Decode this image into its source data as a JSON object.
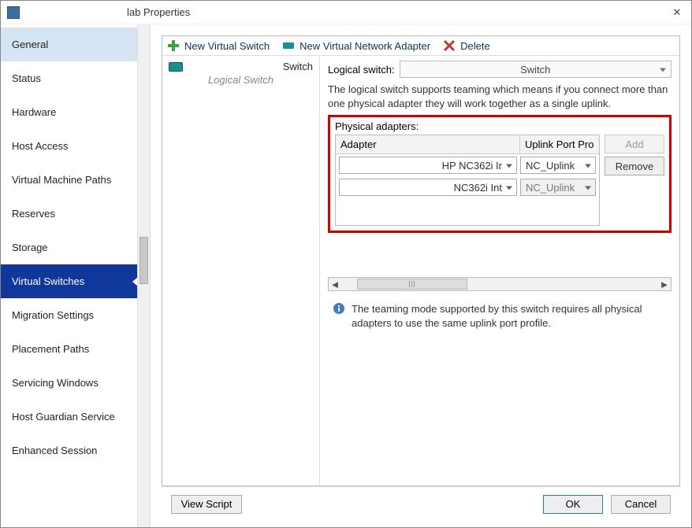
{
  "window": {
    "title": "lab Properties"
  },
  "nav": {
    "items": [
      "General",
      "Status",
      "Hardware",
      "Host Access",
      "Virtual Machine Paths",
      "Reserves",
      "Storage",
      "Virtual Switches",
      "Migration Settings",
      "Placement Paths",
      "Servicing Windows",
      "Host Guardian Service",
      "Enhanced Session"
    ],
    "highlighted": "General",
    "selected": "Virtual Switches"
  },
  "toolbar": {
    "new_switch": "New Virtual Switch",
    "new_adapter": "New Virtual Network Adapter",
    "delete": "Delete"
  },
  "switch_list": {
    "name": "Switch",
    "subtitle": "Logical Switch"
  },
  "detail": {
    "logical_switch_label": "Logical switch:",
    "logical_switch_value": "Switch",
    "help_text": "The logical switch supports teaming which means if you connect more than one physical adapter they will work together as a single uplink.",
    "physical_adapters_label": "Physical adapters:",
    "columns": {
      "adapter": "Adapter",
      "uplink": "Uplink Port Pro"
    },
    "rows": [
      {
        "adapter": "HP NC362i Ir",
        "uplink": "NC_Uplink",
        "uplink_disabled": false
      },
      {
        "adapter": "NC362i Int",
        "uplink": "NC_Uplink",
        "uplink_disabled": true
      }
    ],
    "add_button": "Add",
    "remove_button": "Remove",
    "info_text": "The teaming mode supported by this switch requires all physical adapters to use the same uplink port profile."
  },
  "footer": {
    "view_script": "View Script",
    "ok": "OK",
    "cancel": "Cancel"
  }
}
